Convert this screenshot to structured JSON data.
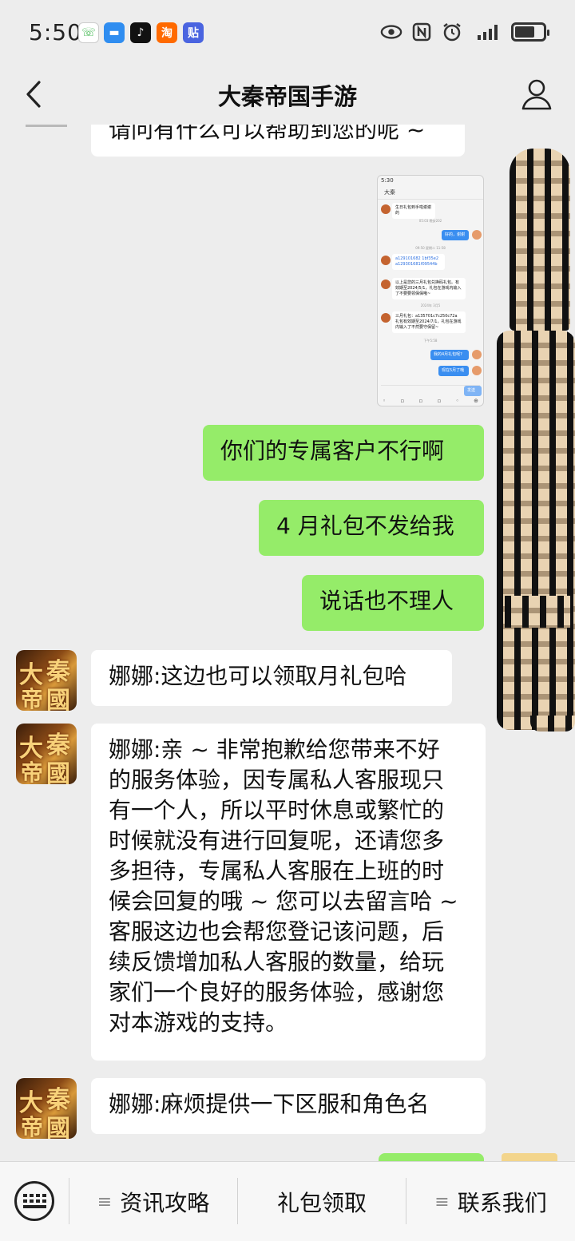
{
  "status": {
    "time": "5:50",
    "icons": [
      "phone-app-icon",
      "message-app-icon",
      "tiktok-app-icon",
      "taobao-app-icon",
      "tieba-app-icon"
    ],
    "right_icons": [
      "eye-icon",
      "nfc-icon",
      "alarm-icon",
      "signal-icon",
      "battery-icon"
    ],
    "battery_level": 0.7
  },
  "header": {
    "title": "大秦帝国手游"
  },
  "messages": {
    "top_partial": "请问有什么可以帮助到您的呢 ~",
    "right1": "你们的专属客户不行啊",
    "right2": "4 月礼包不发给我",
    "right3": "说话也不理人",
    "left1": "娜娜:这边也可以领取月礼包哈",
    "left2_lines": [
      "娜娜:亲 ~ 非常抱歉给您带来不好",
      "的服务体验，因专属私人客服现只",
      "有一个人，所以平时休息或繁忙的",
      "时候就没有进行回复呢，还请您多",
      "多担待，专属私人客服在上班的时",
      "候会回复的哦 ~ 您可以去留言哈 ~",
      "客服这边也会帮您登记该问题，后",
      "续反馈增加私人客服的数量，给玩",
      "家们一个良好的服务体验，感谢您",
      "对本游戏的支持。"
    ],
    "left3": "娜娜:麻烦提供一下区服和角色名"
  },
  "avatar_text": {
    "c1": "大",
    "c2": "秦",
    "c3": "帝",
    "c4": "國"
  },
  "thumbnail": {
    "time": "5:30",
    "contact": "大秦",
    "m1": "生日礼包到手啦谢谢的",
    "t1": "05:03 晚安202",
    "m2": "好的，谢谢",
    "t2": "09:50 星期二 11:58",
    "m3": "a129101682 1bf35e2 a129301681f09544b",
    "m4": "以上是您的三月礼包兑换码礼包。有效期至2024/5/1，礼包在游戏内输入了不要要领保保哦~",
    "t3": "2024年 3月5",
    "m5": "三月礼包：a135701c7c250c72a 礼包有效期至2024/7/1，礼包在游戏内输入了不然要守保留~",
    "t4": "下午5:58",
    "m6": "我的4月礼包呢?",
    "m7": "现在5月了哦",
    "send": "发送"
  },
  "bottom": {
    "menu1": "资讯攻略",
    "menu2": "礼包领取",
    "menu3": "联系我们",
    "menu_icon": "≡"
  },
  "colors": {
    "background": "#ededed",
    "bubble_right": "#95ec69",
    "bubble_left": "#ffffff"
  }
}
